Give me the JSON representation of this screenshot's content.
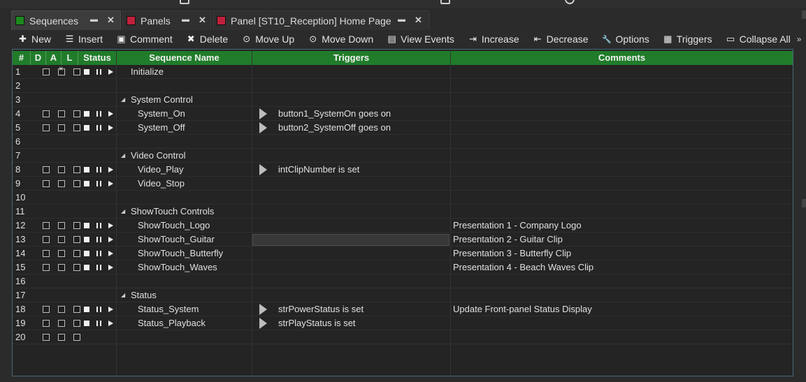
{
  "tabs": [
    {
      "label": "Sequences",
      "color": "#1e8a1e",
      "active": true
    },
    {
      "label": "Panels",
      "color": "#c0203a",
      "active": false
    },
    {
      "label": "Panel [ST10_Reception] Home Page",
      "color": "#c0203a",
      "active": false
    }
  ],
  "toolbar": [
    {
      "icon": "plus-icon",
      "label": "New"
    },
    {
      "icon": "insert-icon",
      "label": "Insert"
    },
    {
      "icon": "comment-icon",
      "label": "Comment"
    },
    {
      "icon": "delete-icon",
      "label": "Delete"
    },
    {
      "icon": "move-up-icon",
      "label": "Move Up"
    },
    {
      "icon": "move-down-icon",
      "label": "Move Down"
    },
    {
      "icon": "view-events-icon",
      "label": "View Events"
    },
    {
      "icon": "increase-icon",
      "label": "Increase"
    },
    {
      "icon": "decrease-icon",
      "label": "Decrease"
    },
    {
      "icon": "wrench-icon",
      "label": "Options"
    },
    {
      "icon": "triggers-icon",
      "label": "Triggers"
    },
    {
      "icon": "collapse-icon",
      "label": "Collapse All"
    }
  ],
  "columns": {
    "num": "#",
    "d": "D",
    "a": "A",
    "l": "L",
    "status": "Status",
    "name": "Sequence Name",
    "triggers": "Triggers",
    "comments": "Comments"
  },
  "rows": [
    {
      "num": "1",
      "type": "seq",
      "name": "Initialize",
      "indent": 0,
      "a_checked": true,
      "trigger": "",
      "comment": ""
    },
    {
      "num": "2",
      "type": "empty"
    },
    {
      "num": "3",
      "type": "group",
      "name": "System Control"
    },
    {
      "num": "4",
      "type": "seq",
      "name": "System_On",
      "indent": 1,
      "trigger": "button1_SystemOn goes on",
      "comment": ""
    },
    {
      "num": "5",
      "type": "seq",
      "name": "System_Off",
      "indent": 1,
      "trigger": "button2_SystemOff goes on",
      "comment": ""
    },
    {
      "num": "6",
      "type": "empty"
    },
    {
      "num": "7",
      "type": "group",
      "name": "Video Control"
    },
    {
      "num": "8",
      "type": "seq",
      "name": "Video_Play",
      "indent": 1,
      "trigger": "intClipNumber is set",
      "comment": ""
    },
    {
      "num": "9",
      "type": "seq",
      "name": "Video_Stop",
      "indent": 1,
      "trigger": "",
      "comment": ""
    },
    {
      "num": "10",
      "type": "empty"
    },
    {
      "num": "11",
      "type": "group",
      "name": "ShowTouch Controls"
    },
    {
      "num": "12",
      "type": "seq",
      "name": "ShowTouch_Logo",
      "indent": 1,
      "trigger": "",
      "comment": "Presentation 1 - Company Logo"
    },
    {
      "num": "13",
      "type": "seq",
      "name": "ShowTouch_Guitar",
      "indent": 1,
      "trigger": "",
      "comment": "Presentation 2 - Guitar Clip",
      "selected_trigger": true
    },
    {
      "num": "14",
      "type": "seq",
      "name": "ShowTouch_Butterfly",
      "indent": 1,
      "trigger": "",
      "comment": "Presentation 3 - Butterfly Clip"
    },
    {
      "num": "15",
      "type": "seq",
      "name": "ShowTouch_Waves",
      "indent": 1,
      "trigger": "",
      "comment": "Presentation 4 - Beach Waves Clip"
    },
    {
      "num": "16",
      "type": "empty"
    },
    {
      "num": "17",
      "type": "group",
      "name": "Status"
    },
    {
      "num": "18",
      "type": "seq",
      "name": "Status_System",
      "indent": 1,
      "trigger": "strPowerStatus is set",
      "comment": "Update Front-panel Status Display"
    },
    {
      "num": "19",
      "type": "seq",
      "name": "Status_Playback",
      "indent": 1,
      "trigger": "strPlayStatus is set",
      "comment": ""
    },
    {
      "num": "20",
      "type": "blank-seq"
    }
  ]
}
